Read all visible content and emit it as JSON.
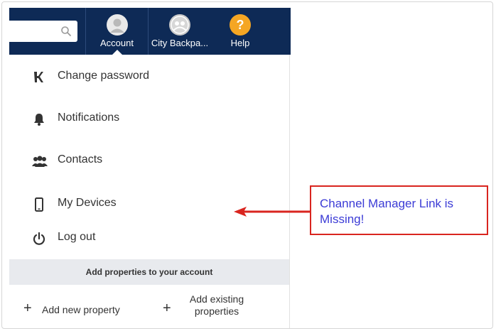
{
  "nav": {
    "account_label": "Account",
    "property_label": "City Backpa...",
    "help_label": "Help"
  },
  "menu": {
    "items": [
      {
        "label": "Change password",
        "icon": "key-icon"
      },
      {
        "label": "Notifications",
        "icon": "bell-icon"
      },
      {
        "label": "Contacts",
        "icon": "users-icon"
      },
      {
        "label": "My Devices",
        "icon": "phone-icon"
      },
      {
        "label": "Log out",
        "icon": "power-icon"
      }
    ],
    "add_header": "Add properties to your account",
    "add_new": "Add new property",
    "add_existing_line1": "Add existing",
    "add_existing_line2": "properties"
  },
  "annotation": {
    "text": "Channel Manager Link is Missing!"
  },
  "colors": {
    "navbar": "#0e2a56",
    "help_badge": "#f5a623",
    "callout_border": "#d9251f",
    "callout_text": "#3b3bd6",
    "arrow": "#d9251f"
  }
}
